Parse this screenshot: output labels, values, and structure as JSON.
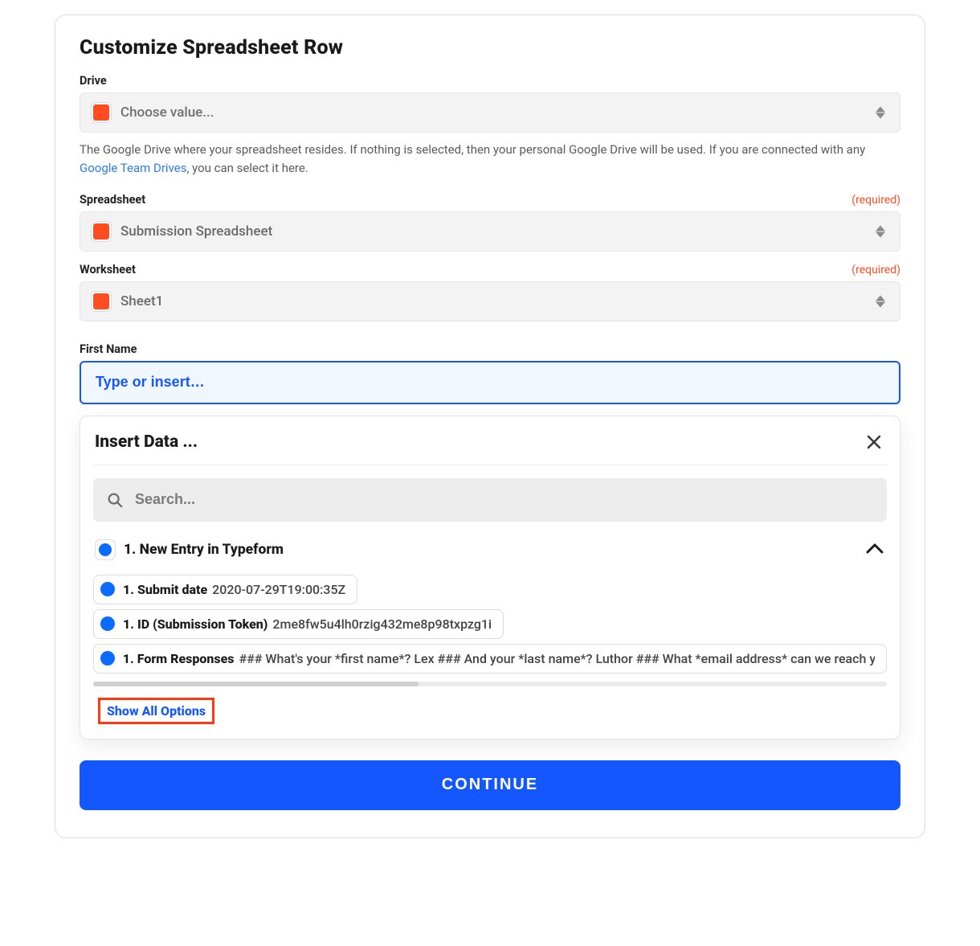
{
  "page": {
    "title": "Customize Spreadsheet Row"
  },
  "drive": {
    "label": "Drive",
    "placeholder": "Choose value...",
    "help_pre": "The Google Drive where your spreadsheet resides. If nothing is selected, then your personal Google Drive will be used. If you are connected with any ",
    "help_link_text": "Google Team Drives",
    "help_post": ", you can select it here."
  },
  "spreadsheet": {
    "label": "Spreadsheet",
    "required": "(required)",
    "value": "Submission Spreadsheet"
  },
  "worksheet": {
    "label": "Worksheet",
    "required": "(required)",
    "value": "Sheet1"
  },
  "firstname": {
    "label": "First Name",
    "placeholder": "Type or insert…"
  },
  "popover": {
    "title": "Insert Data ...",
    "search_placeholder": "Search...",
    "group_title": "1. New Entry in Typeform",
    "items": [
      {
        "label": "1. Submit date",
        "value": "2020-07-29T19:00:35Z"
      },
      {
        "label": "1. ID (Submission Token)",
        "value": "2me8fw5u4lh0rzig432me8p98txpzg1i"
      },
      {
        "label": "1. Form Responses",
        "value": "### What's your *first name*? Lex ### And your *last name*? Luthor ### What *email address* can we reach yo"
      }
    ],
    "show_all": "Show All Options"
  },
  "continue_label": "CONTINUE"
}
